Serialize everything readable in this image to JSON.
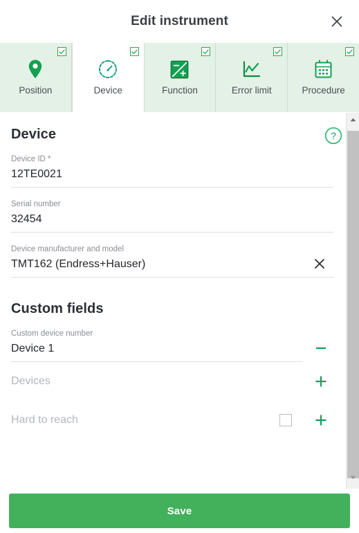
{
  "header": {
    "title": "Edit instrument",
    "close_icon": "close-icon"
  },
  "tabs": [
    {
      "label": "Position",
      "icon": "map-pin-icon",
      "checked": true,
      "active": false
    },
    {
      "label": "Device",
      "icon": "gauge-icon",
      "checked": true,
      "active": true
    },
    {
      "label": "Function",
      "icon": "function-icon",
      "checked": true,
      "active": false
    },
    {
      "label": "Error limit",
      "icon": "line-chart-icon",
      "checked": true,
      "active": false
    },
    {
      "label": "Procedure",
      "icon": "calendar-icon",
      "checked": true,
      "active": false
    }
  ],
  "device_section": {
    "title": "Device",
    "help_icon": "question-circle-icon",
    "fields": [
      {
        "label": "Device ID *",
        "value": "12TE0021",
        "placeholder": "",
        "clearable": false
      },
      {
        "label": "Serial number",
        "value": "32454",
        "placeholder": "",
        "clearable": false
      },
      {
        "label": "Device manufacturer and model",
        "value": "TMT162 (Endress+Hauser)",
        "placeholder": "",
        "clearable": true
      }
    ]
  },
  "custom_section": {
    "title": "Custom fields",
    "custom_field": {
      "label": "Custom device number",
      "value": "Device 1",
      "sign": "minus-icon"
    },
    "rows": [
      {
        "placeholder": "Devices",
        "has_checkbox": false,
        "sign": "plus-icon"
      },
      {
        "placeholder": "Hard to reach",
        "has_checkbox": true,
        "checked": false,
        "sign": "plus-icon"
      }
    ]
  },
  "scrollbar": {
    "up_icon": "caret-up-icon",
    "down_icon": "caret-down-icon",
    "thumb": "scrollbar-thumb"
  },
  "footer": {
    "save_label": "Save"
  },
  "colors": {
    "accent_green": "#1f9e5e",
    "save_green": "#43b05c",
    "tab_bg": "#e4f1e6",
    "label_gray": "#8a8d93",
    "placeholder_gray": "#b3b6bb"
  }
}
